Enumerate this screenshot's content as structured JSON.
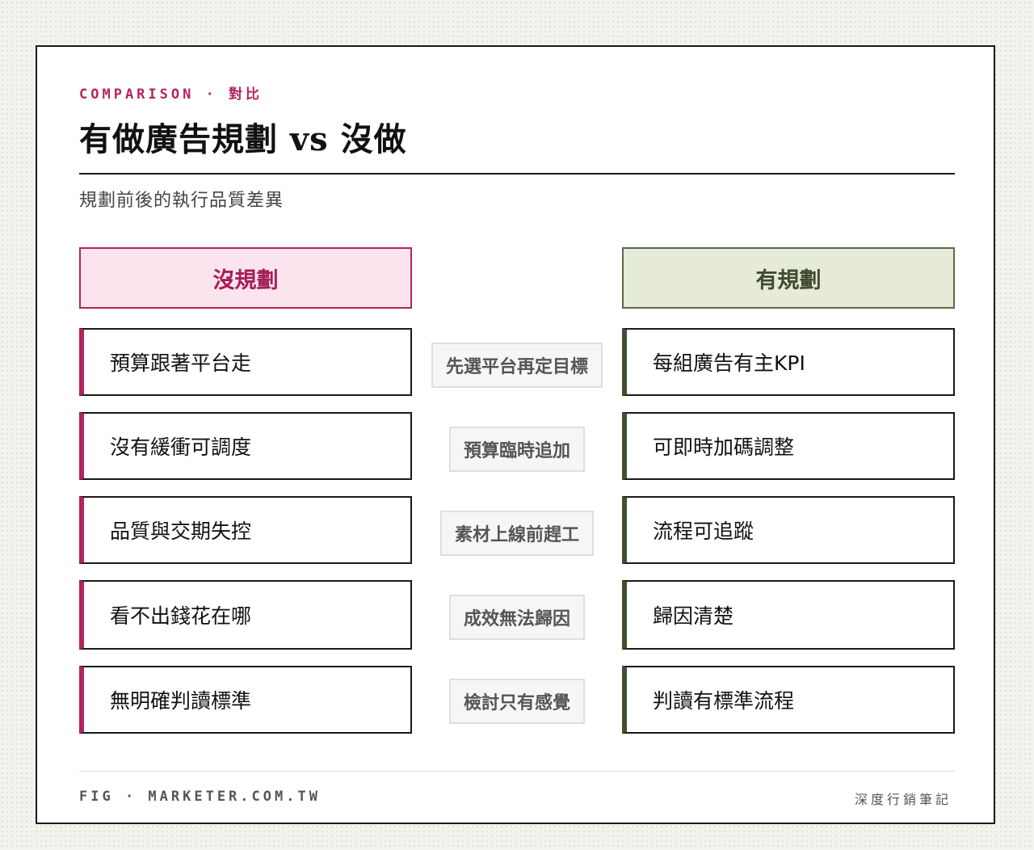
{
  "header": {
    "eyebrow": "COMPARISON · 對比",
    "title": "有做廣告規劃 vs 沒做",
    "subtitle": "規劃前後的執行品質差異"
  },
  "columns": {
    "bad_label": "沒規劃",
    "good_label": "有規劃"
  },
  "rows": [
    {
      "bad": "預算跟著平台走",
      "middle": "先選平台再定目標",
      "good": "每組廣告有主KPI"
    },
    {
      "bad": "沒有緩衝可調度",
      "middle": "預算臨時追加",
      "good": "可即時加碼調整"
    },
    {
      "bad": "品質與交期失控",
      "middle": "素材上線前趕工",
      "good": "流程可追蹤"
    },
    {
      "bad": "看不出錢花在哪",
      "middle": "成效無法歸因",
      "good": "歸因清楚"
    },
    {
      "bad": "無明確判讀標準",
      "middle": "檢討只有感覺",
      "good": "判讀有標準流程"
    }
  ],
  "footer": {
    "left": "FIG · MARKETER.COM.TW",
    "right": "深度行銷筆記"
  },
  "colors": {
    "bad_accent": "#b3245e",
    "bad_fill": "#fbe4ee",
    "good_accent": "#3f5230",
    "good_fill": "#e5ead9"
  }
}
